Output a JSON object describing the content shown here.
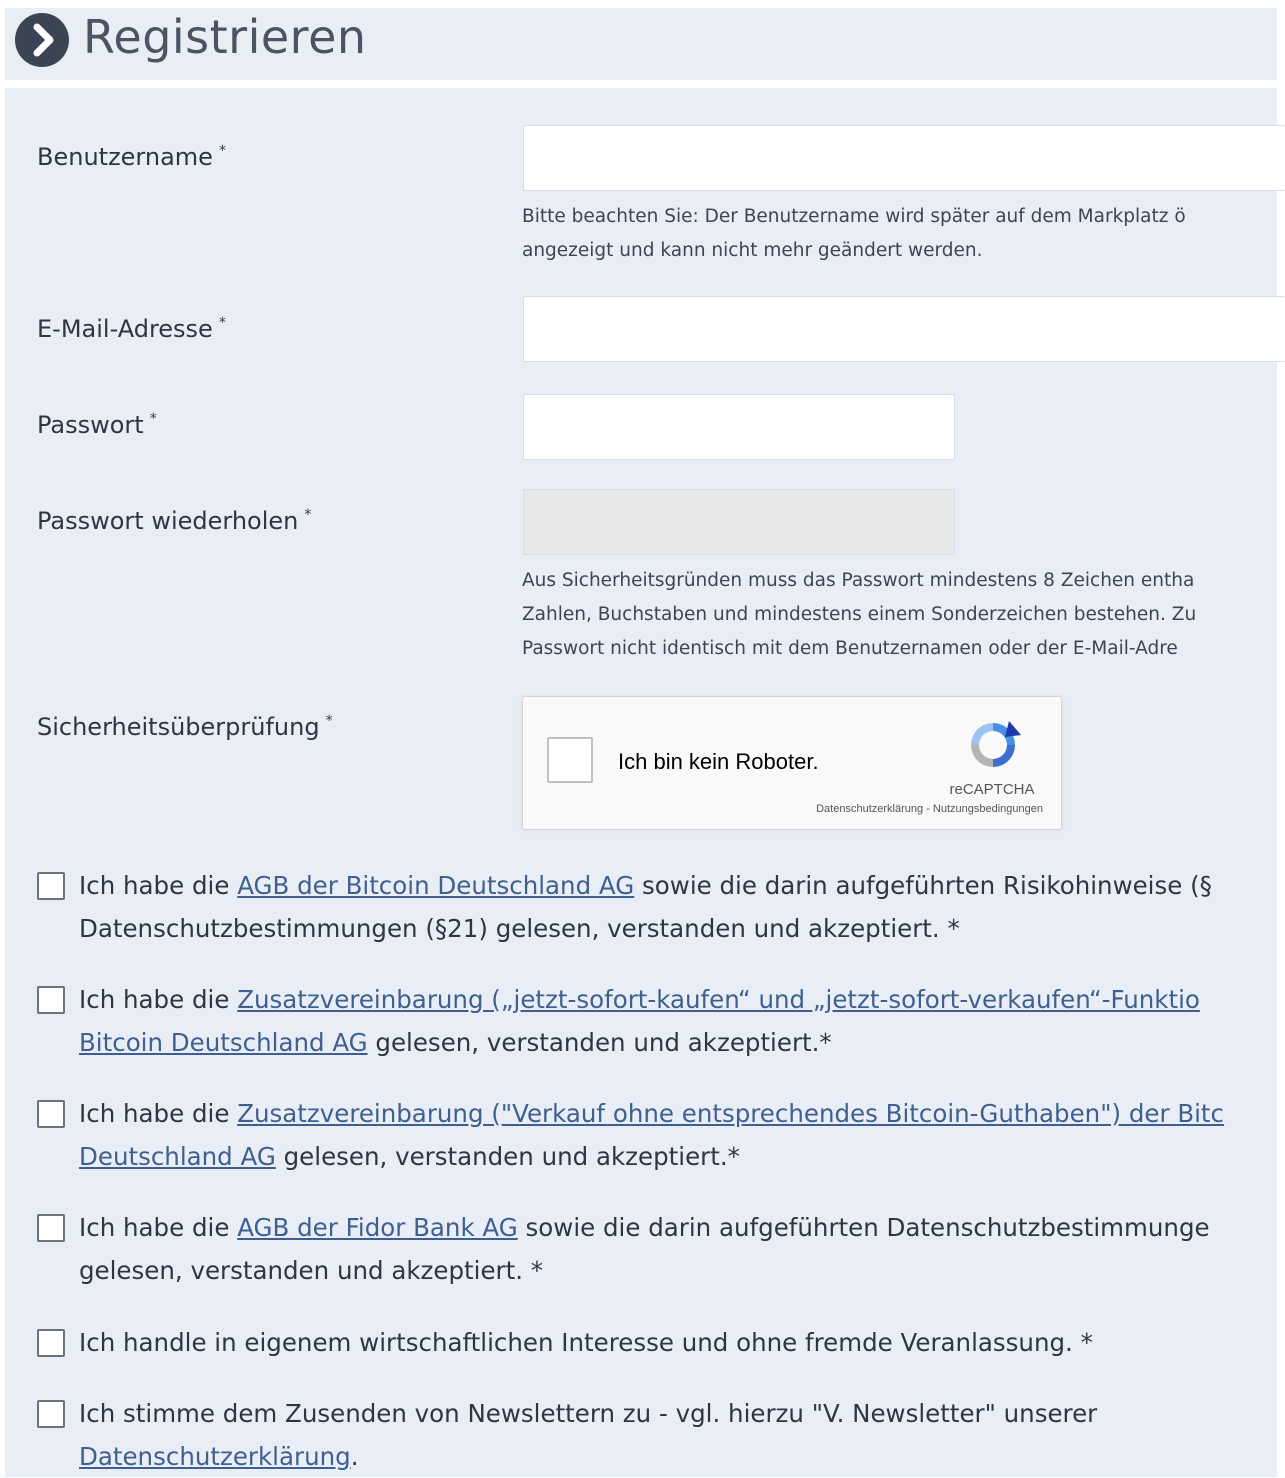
{
  "header": {
    "title": "Registrieren",
    "icon": "chevron-right-circle-icon"
  },
  "form": {
    "required_mark": "*",
    "username": {
      "label": "Benutzername",
      "hint_line1": "Bitte beachten Sie: Der Benutzername wird später auf dem Markplatz ö",
      "hint_line2": "angezeigt und kann nicht mehr geändert werden."
    },
    "email": {
      "label": "E-Mail-Adresse"
    },
    "password": {
      "label": "Passwort"
    },
    "password_repeat": {
      "label": "Passwort wiederholen",
      "hint_line1": "Aus Sicherheitsgründen muss das Passwort mindestens 8 Zeichen entha",
      "hint_line2": "Zahlen, Buchstaben und mindestens einem Sonderzeichen bestehen. Zu",
      "hint_line3": "Passwort nicht identisch mit dem Benutzernamen oder der E-Mail-Adre"
    },
    "security": {
      "label": "Sicherheitsüberprüfung",
      "captcha_text": "Ich bin kein Roboter.",
      "captcha_brand": "reCAPTCHA",
      "privacy_link": "Datenschutzerklärung",
      "separator": " - ",
      "terms_link": "Nutzungsbedingungen"
    }
  },
  "consents": [
    {
      "prefix": "Ich habe die ",
      "link": "AGB der Bitcoin Deutschland AG",
      "suffix": " sowie die darin aufgeführten Risikohinweise (§",
      "line2": "Datenschutzbestimmungen (§21) gelesen, verstanden und akzeptiert. *"
    },
    {
      "prefix": "Ich habe die ",
      "link": "Zusatzvereinbarung („jetzt-sofort-kaufen“ und „jetzt-sofort-verkaufen“-Funktio",
      "line2_link": "Bitcoin Deutschland AG",
      "line2_suffix": " gelesen, verstanden und akzeptiert.*"
    },
    {
      "prefix": "Ich habe die ",
      "link": "Zusatzvereinbarung (\"Verkauf ohne entsprechendes Bitcoin-Guthaben\") der Bitc",
      "line2_link": "Deutschland AG",
      "line2_suffix": " gelesen, verstanden und akzeptiert.*"
    },
    {
      "prefix": "Ich habe die ",
      "link": "AGB der Fidor Bank AG",
      "suffix": " sowie die darin aufgeführten Datenschutzbestimmunge",
      "line2": "gelesen, verstanden und akzeptiert. *"
    },
    {
      "text": "Ich handle in eigenem wirtschaftlichen Interesse und ohne fremde Veranlassung. *"
    },
    {
      "text": "Ich stimme dem Zusenden von Newslettern zu - vgl. hierzu \"V. Newsletter\" unserer",
      "line2_link": "Datenschutzerklärung",
      "line2_suffix": "."
    }
  ],
  "colors": {
    "panel_bg": "#e9eef6",
    "link": "#3f5f8f",
    "header_icon": "#3a4452"
  }
}
